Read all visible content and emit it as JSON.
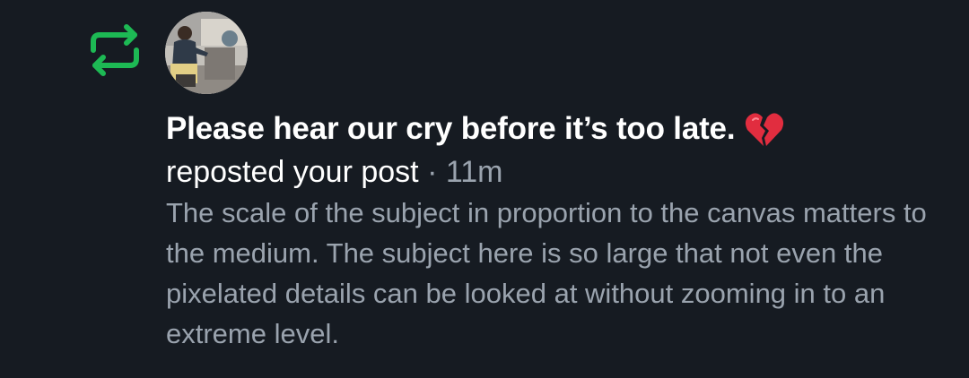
{
  "notification": {
    "type_icon": "repost-icon",
    "accent_color": "#1db954",
    "avatar": {
      "icon": "user-avatar-photo"
    },
    "author": {
      "name": "Please hear our cry before it’s too late.",
      "emoji_icon": "broken-heart-icon"
    },
    "action": {
      "text": "reposted your post",
      "separator": "·",
      "time": "11m"
    },
    "post": {
      "text": "The scale of the subject in proportion to the canvas matters to the medium. The subject here is so large that not even the pixelated details can be looked at without zooming in to an extreme level."
    }
  },
  "colors": {
    "background": "#161b22",
    "primary_text": "#ffffff",
    "secondary_text": "#9aa3ae"
  }
}
